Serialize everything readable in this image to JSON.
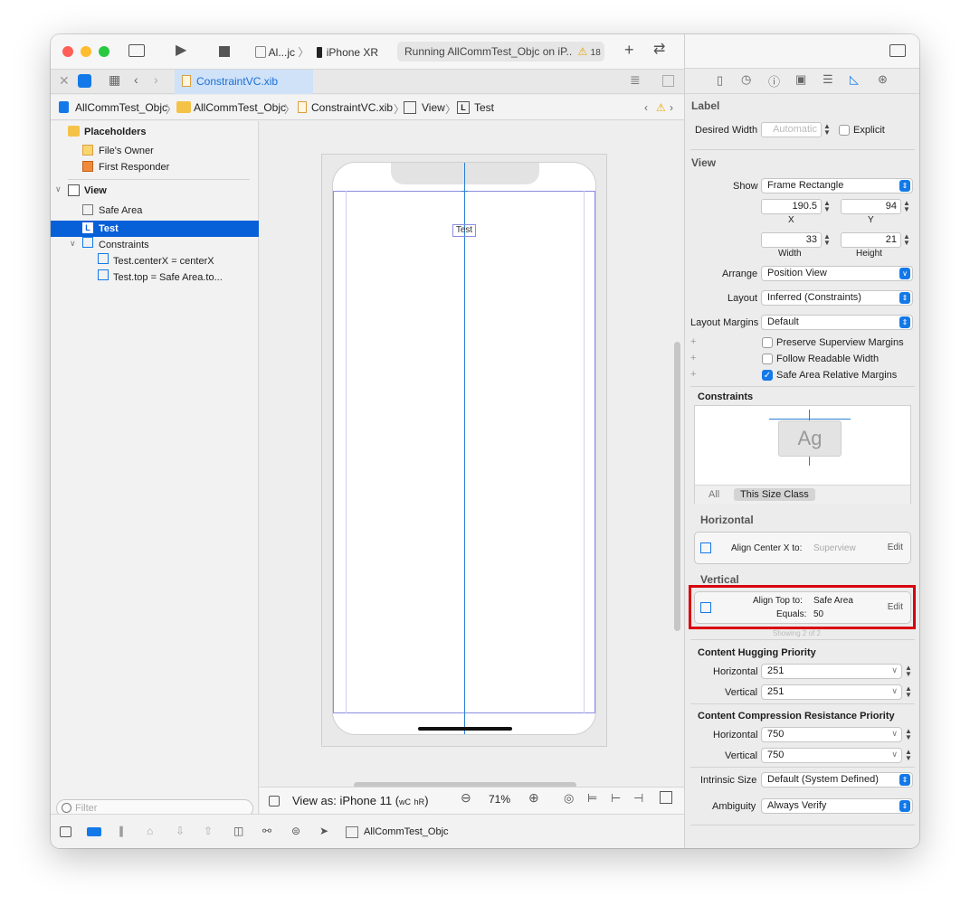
{
  "toolbar": {
    "scheme_target": "Al...jc",
    "device": "iPhone XR",
    "status_text": "Running AllCommTest_Objc on iP..",
    "warning_count": "18"
  },
  "tabs": {
    "active": "ConstraintVC.xib"
  },
  "jumpbar": {
    "items": [
      "AllCommTest_Objc",
      "AllCommTest_Objc",
      "ConstraintVC.xib",
      "View",
      "Test"
    ]
  },
  "navigator": {
    "placeholders": "Placeholders",
    "files_owner": "File's Owner",
    "first_responder": "First Responder",
    "view": "View",
    "safe_area": "Safe Area",
    "test": "Test",
    "constraints": "Constraints",
    "constraint_1": "Test.centerX = centerX",
    "constraint_2": "Test.top = Safe Area.to...",
    "filter_placeholder": "Filter"
  },
  "canvas": {
    "label_text": "Test",
    "view_as": "View as: iPhone 11 (",
    "size_class_w": "wC",
    "size_class_h": "hR",
    "view_as_close": ")",
    "zoom": "71%"
  },
  "statusbar": {
    "scheme": "AllCommTest_Objc"
  },
  "inspector": {
    "label_header": "Label",
    "desired_width_label": "Desired Width",
    "desired_width_value": "Automatic",
    "explicit_label": "Explicit",
    "view_header": "View",
    "show_label": "Show",
    "show_value": "Frame Rectangle",
    "x_value": "190.5",
    "x_label": "X",
    "y_value": "94",
    "y_label": "Y",
    "width_value": "33",
    "width_label": "Width",
    "height_value": "21",
    "height_label": "Height",
    "arrange_label": "Arrange",
    "arrange_value": "Position View",
    "layout_label": "Layout",
    "layout_value": "Inferred (Constraints)",
    "margins_label": "Layout Margins",
    "margins_value": "Default",
    "preserve_label": "Preserve Superview Margins",
    "readable_label": "Follow Readable Width",
    "safe_area_label": "Safe Area Relative Margins",
    "constraints_header": "Constraints",
    "constraints_preview_text": "Ag",
    "seg_all": "All",
    "seg_size_class": "This Size Class",
    "horizontal_header": "Horizontal",
    "h_constraint_label": "Align Center X to:",
    "h_constraint_target": "Superview",
    "edit_label": "Edit",
    "vertical_header": "Vertical",
    "v_constraint_label": "Align Top to:",
    "v_constraint_target": "Safe Area",
    "v_equals_label": "Equals:",
    "v_equals_value": "50",
    "showing": "Showing 2 of 2",
    "hugging_header": "Content Hugging Priority",
    "hug_h_label": "Horizontal",
    "hug_h_value": "251",
    "hug_v_label": "Vertical",
    "hug_v_value": "251",
    "compression_header": "Content Compression Resistance Priority",
    "comp_h_label": "Horizontal",
    "comp_h_value": "750",
    "comp_v_label": "Vertical",
    "comp_v_value": "750",
    "intrinsic_label": "Intrinsic Size",
    "intrinsic_value": "Default (System Defined)",
    "ambiguity_label": "Ambiguity",
    "ambiguity_value": "Always Verify"
  },
  "colors": {
    "accent": "#0860d8",
    "highlight_box": "#d9000f"
  }
}
